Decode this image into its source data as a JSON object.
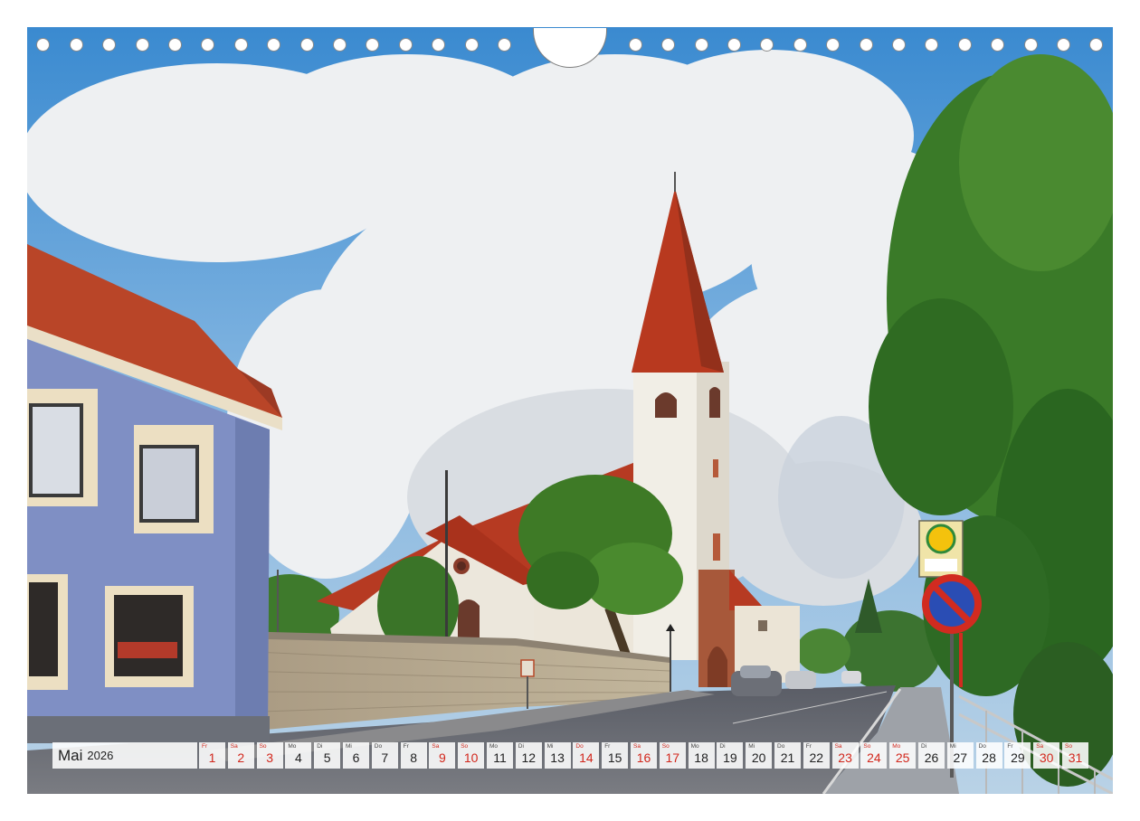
{
  "calendar": {
    "month": "Mai",
    "year": "2026",
    "days": [
      {
        "wd": "Fr",
        "num": "1",
        "red": true
      },
      {
        "wd": "Sa",
        "num": "2",
        "red": true
      },
      {
        "wd": "So",
        "num": "3",
        "red": true
      },
      {
        "wd": "Mo",
        "num": "4",
        "red": false
      },
      {
        "wd": "Di",
        "num": "5",
        "red": false
      },
      {
        "wd": "Mi",
        "num": "6",
        "red": false
      },
      {
        "wd": "Do",
        "num": "7",
        "red": false
      },
      {
        "wd": "Fr",
        "num": "8",
        "red": false
      },
      {
        "wd": "Sa",
        "num": "9",
        "red": true
      },
      {
        "wd": "So",
        "num": "10",
        "red": true
      },
      {
        "wd": "Mo",
        "num": "11",
        "red": false
      },
      {
        "wd": "Di",
        "num": "12",
        "red": false
      },
      {
        "wd": "Mi",
        "num": "13",
        "red": false
      },
      {
        "wd": "Do",
        "num": "14",
        "red": true
      },
      {
        "wd": "Fr",
        "num": "15",
        "red": false
      },
      {
        "wd": "Sa",
        "num": "16",
        "red": true
      },
      {
        "wd": "So",
        "num": "17",
        "red": true
      },
      {
        "wd": "Mo",
        "num": "18",
        "red": false
      },
      {
        "wd": "Di",
        "num": "19",
        "red": false
      },
      {
        "wd": "Mi",
        "num": "20",
        "red": false
      },
      {
        "wd": "Do",
        "num": "21",
        "red": false
      },
      {
        "wd": "Fr",
        "num": "22",
        "red": false
      },
      {
        "wd": "Sa",
        "num": "23",
        "red": true
      },
      {
        "wd": "So",
        "num": "24",
        "red": true
      },
      {
        "wd": "Mo",
        "num": "25",
        "red": true
      },
      {
        "wd": "Di",
        "num": "26",
        "red": false
      },
      {
        "wd": "Mi",
        "num": "27",
        "red": false
      },
      {
        "wd": "Do",
        "num": "28",
        "red": false
      },
      {
        "wd": "Fr",
        "num": "29",
        "red": false
      },
      {
        "wd": "Sa",
        "num": "30",
        "red": true
      },
      {
        "wd": "So",
        "num": "31",
        "red": true
      }
    ]
  },
  "colors": {
    "holiday_red": "#d2271c",
    "roof_red": "#b63a22",
    "house_blue": "#7f8fc4",
    "sky_blue": "#3f8fd2"
  }
}
